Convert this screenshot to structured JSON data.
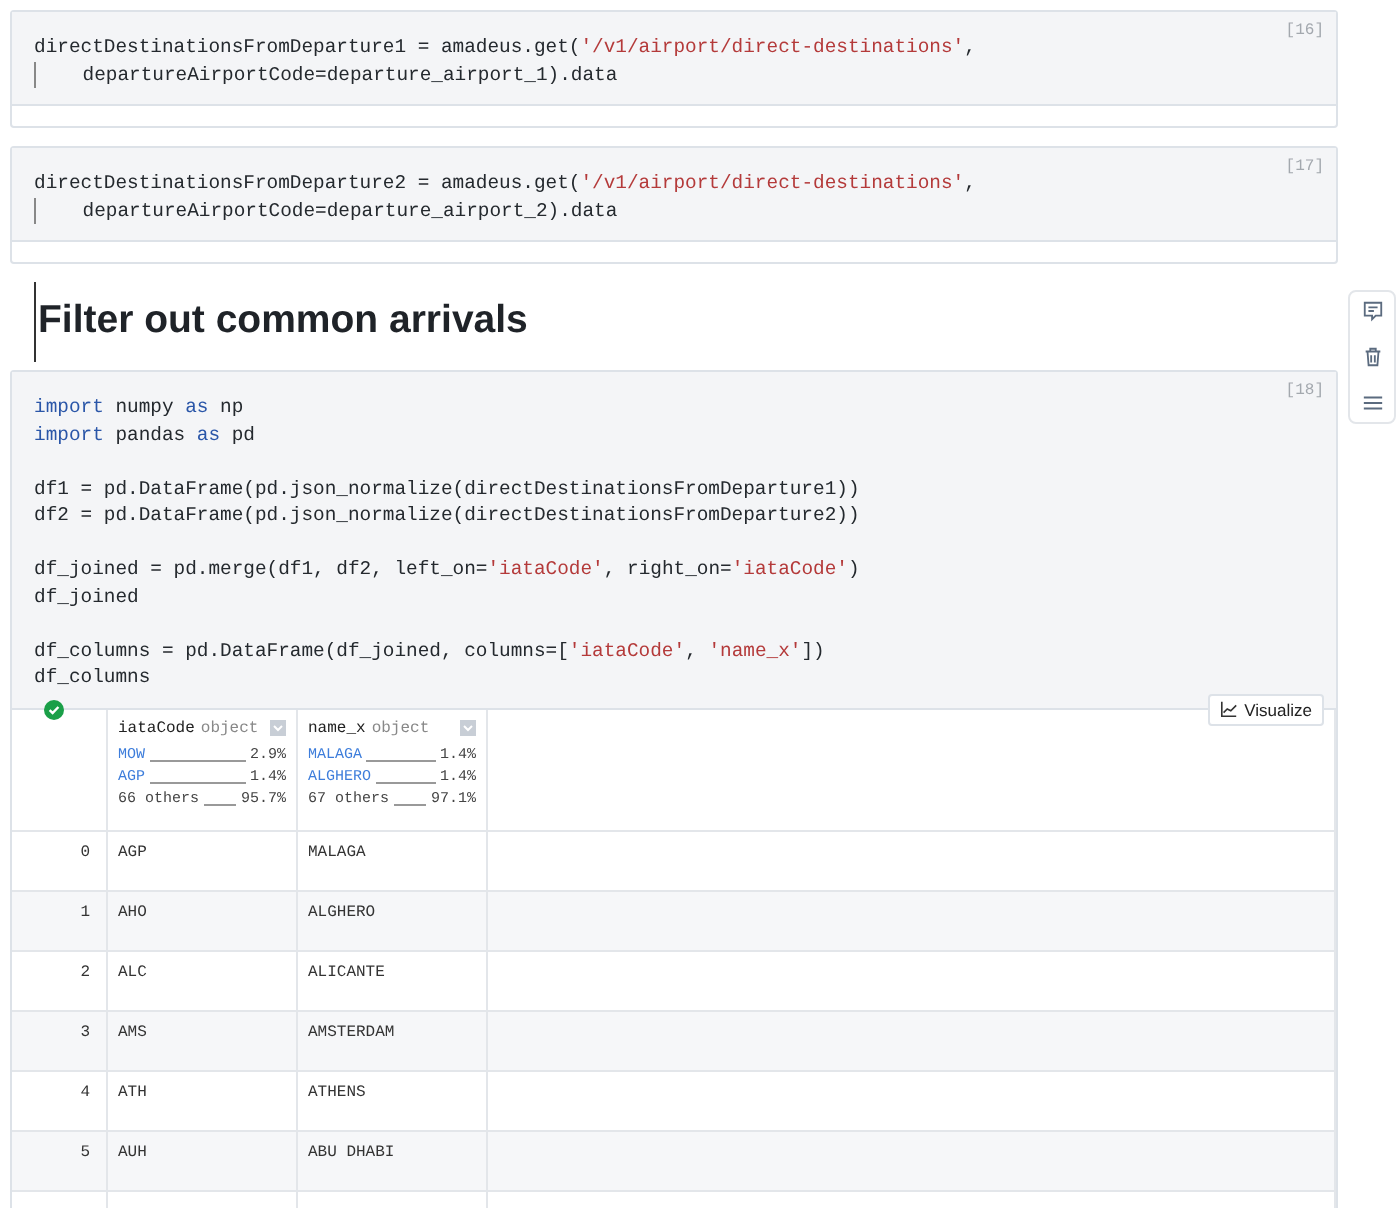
{
  "cells": [
    {
      "kind": "code",
      "count": "[16]",
      "lines": [
        [
          {
            "kind": "plain",
            "text": "directDestinationsFromDeparture1 = amadeus.get("
          },
          {
            "kind": "string",
            "text": "'/v1/airport/direct-destinations'"
          },
          {
            "kind": "plain",
            "text": ","
          }
        ],
        [
          {
            "kind": "guide"
          },
          {
            "kind": "plain",
            "text": "    departureAirportCode=departure_airport_1).data"
          }
        ]
      ]
    },
    {
      "kind": "code",
      "count": "[17]",
      "lines": [
        [
          {
            "kind": "plain",
            "text": "directDestinationsFromDeparture2 = amadeus.get("
          },
          {
            "kind": "string",
            "text": "'/v1/airport/direct-destinations'"
          },
          {
            "kind": "plain",
            "text": ","
          }
        ],
        [
          {
            "kind": "guide"
          },
          {
            "kind": "plain",
            "text": "    departureAirportCode=departure_airport_2).data"
          }
        ]
      ]
    },
    {
      "kind": "heading",
      "text": "Filter out common arrivals"
    },
    {
      "kind": "code",
      "count": "[18]",
      "lines": [
        [
          {
            "kind": "keyword",
            "text": "import"
          },
          {
            "kind": "plain",
            "text": " numpy "
          },
          {
            "kind": "keyword",
            "text": "as"
          },
          {
            "kind": "plain",
            "text": " np"
          }
        ],
        [
          {
            "kind": "keyword",
            "text": "import"
          },
          {
            "kind": "plain",
            "text": " pandas "
          },
          {
            "kind": "keyword",
            "text": "as"
          },
          {
            "kind": "plain",
            "text": " pd"
          }
        ],
        [
          {
            "kind": "break"
          }
        ],
        [
          {
            "kind": "plain",
            "text": "df1 = pd.DataFrame(pd.json_normalize(directDestinationsFromDeparture1))"
          }
        ],
        [
          {
            "kind": "plain",
            "text": "df2 = pd.DataFrame(pd.json_normalize(directDestinationsFromDeparture2))"
          }
        ],
        [
          {
            "kind": "break"
          }
        ],
        [
          {
            "kind": "plain",
            "text": "df_joined = pd.merge(df1, df2, left_on="
          },
          {
            "kind": "string",
            "text": "'iataCode'"
          },
          {
            "kind": "plain",
            "text": ", right_on="
          },
          {
            "kind": "string",
            "text": "'iataCode'"
          },
          {
            "kind": "plain",
            "text": ")"
          }
        ],
        [
          {
            "kind": "plain",
            "text": "df_joined"
          }
        ],
        [
          {
            "kind": "break"
          }
        ],
        [
          {
            "kind": "plain",
            "text": "df_columns = pd.DataFrame(df_joined, columns=["
          },
          {
            "kind": "string",
            "text": "'iataCode'"
          },
          {
            "kind": "plain",
            "text": ", "
          },
          {
            "kind": "string",
            "text": "'name_x'"
          },
          {
            "kind": "plain",
            "text": "])"
          }
        ],
        [
          {
            "kind": "plain",
            "text": "df_columns"
          }
        ]
      ],
      "output": {
        "success": true,
        "visualize_label": "Visualize",
        "columns": [
          {
            "name": "iataCode",
            "dtype": "object",
            "stats": [
              {
                "label": "MOW",
                "percent": "2.9%",
                "kind": "value"
              },
              {
                "label": "AGP",
                "percent": "1.4%",
                "kind": "value"
              },
              {
                "label": "66 others",
                "percent": "95.7%",
                "kind": "others"
              }
            ]
          },
          {
            "name": "name_x",
            "dtype": "object",
            "stats": [
              {
                "label": "MALAGA",
                "percent": "1.4%",
                "kind": "value"
              },
              {
                "label": "ALGHERO",
                "percent": "1.4%",
                "kind": "value"
              },
              {
                "label": "67 others",
                "percent": "97.1%",
                "kind": "others"
              }
            ]
          }
        ],
        "rows": [
          {
            "index": "0",
            "cells": [
              "AGP",
              "MALAGA"
            ]
          },
          {
            "index": "1",
            "cells": [
              "AHO",
              "ALGHERO"
            ]
          },
          {
            "index": "2",
            "cells": [
              "ALC",
              "ALICANTE"
            ]
          },
          {
            "index": "3",
            "cells": [
              "AMS",
              "AMSTERDAM"
            ]
          },
          {
            "index": "4",
            "cells": [
              "ATH",
              "ATHENS"
            ]
          },
          {
            "index": "5",
            "cells": [
              "AUH",
              "ABU DHABI"
            ]
          }
        ]
      }
    }
  ]
}
